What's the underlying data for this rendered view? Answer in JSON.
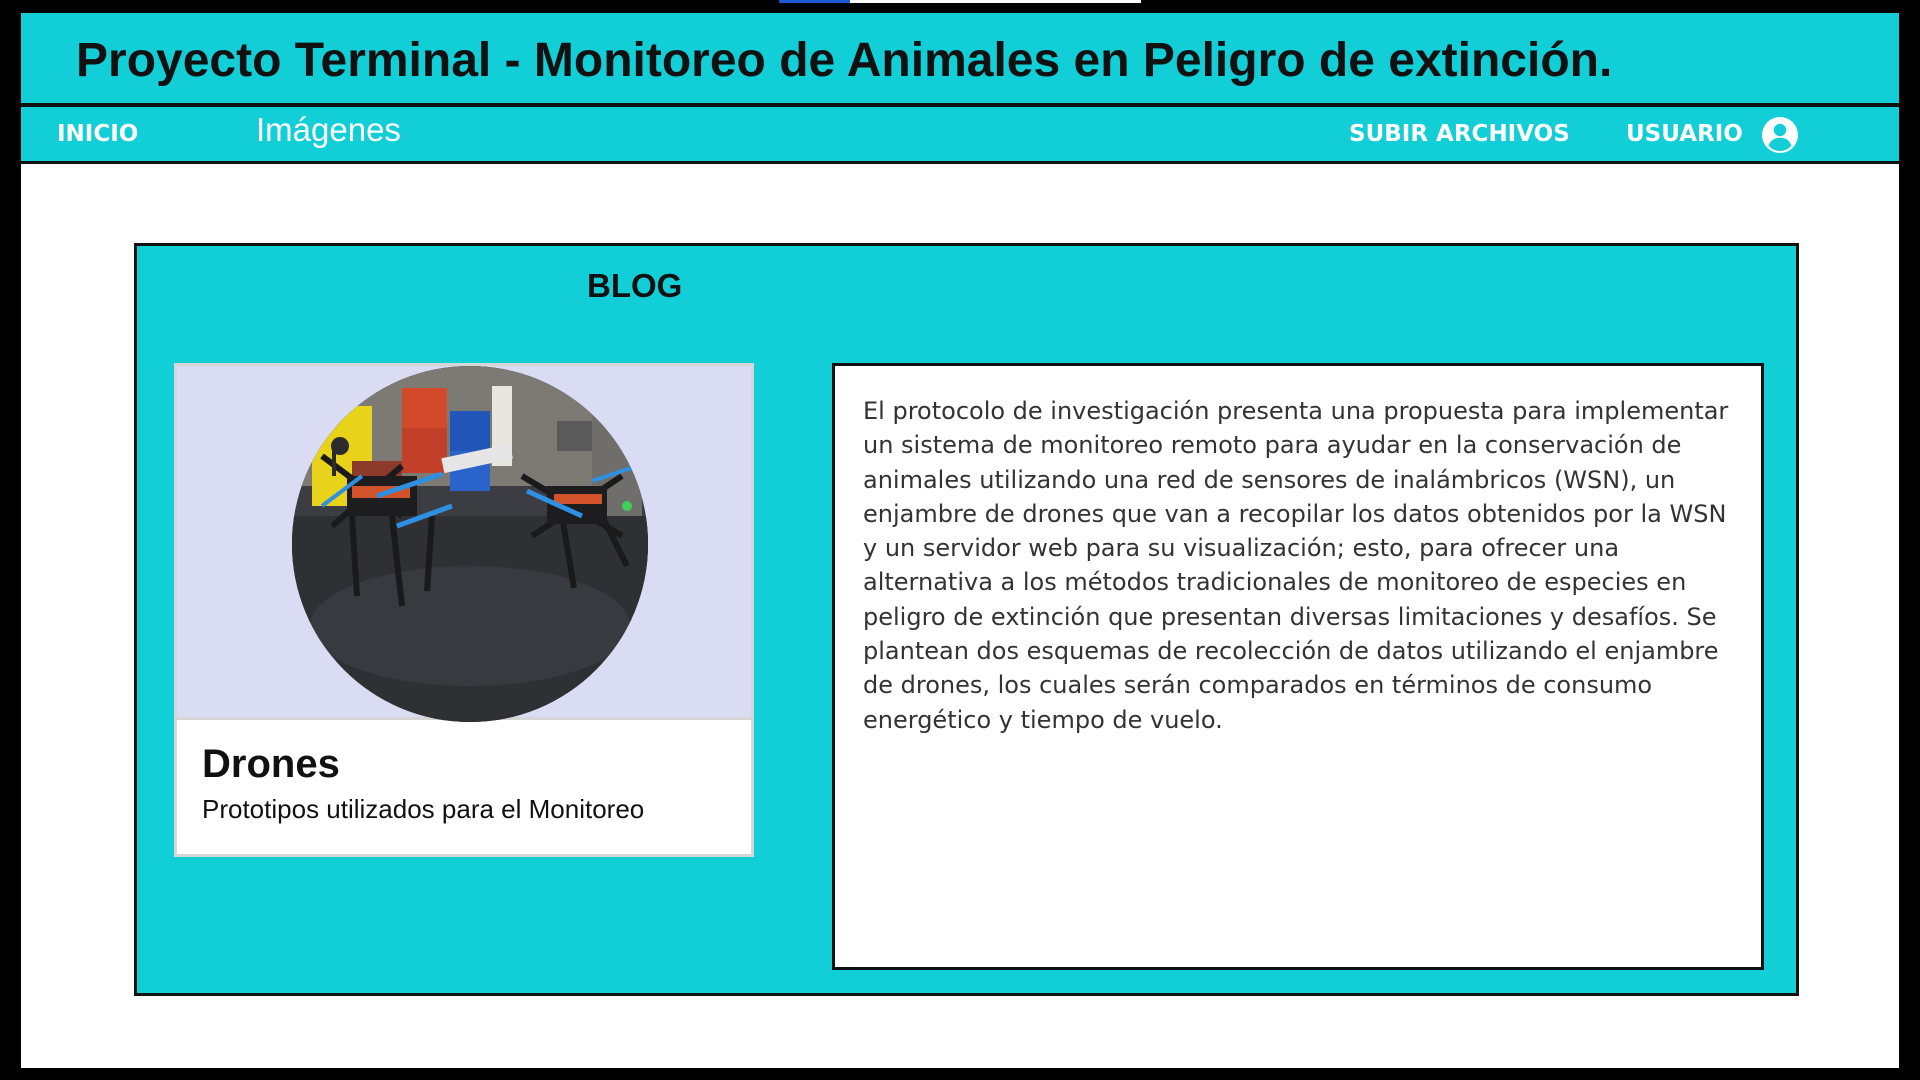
{
  "header": {
    "title": "Proyecto Terminal - Monitoreo de Animales en Peligro de extinción."
  },
  "nav": {
    "inicio": "INICIO",
    "imagenes": "Imágenes",
    "subir_archivos": "SUBIR ARCHIVOS",
    "usuario": "USUARIO",
    "user_icon": "account-circle-icon"
  },
  "blog": {
    "title": "BLOG",
    "card": {
      "title": "Drones",
      "subtitle": "Prototipos utilizados para el Monitoreo",
      "image": "drones-photo"
    },
    "description": "El protocolo de investigación presenta una propuesta para implementar un sistema de monitoreo remoto para ayudar en la conservación de animales utilizando una red de sensores de inalámbricos (WSN), un enjambre de drones que van a recopilar los datos obtenidos por la WSN y un servidor web para su visualización; esto, para ofrecer una alternativa a los métodos tradicionales de monitoreo de especies en peligro de extinción que presentan diversas limitaciones y desafíos. Se plantean dos esquemas de recolección de datos utilizando el enjambre de drones, los cuales serán comparados en términos de consumo energético y tiempo de vuelo."
  },
  "colors": {
    "accent": "#12ced6",
    "text_dark": "#111111",
    "card_media_bg": "#d9dcf2"
  }
}
